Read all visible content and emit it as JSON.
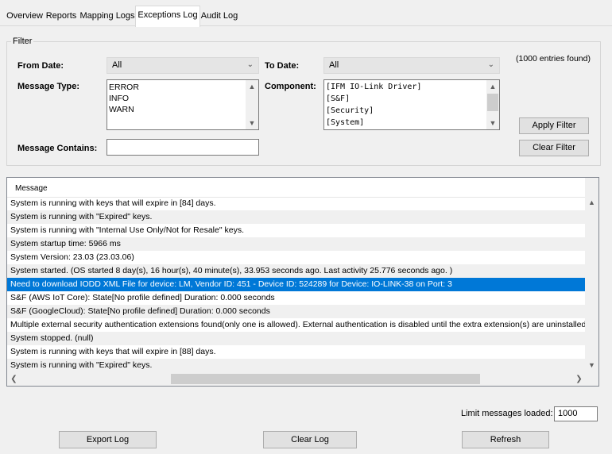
{
  "tabs": [
    {
      "label": "Overview",
      "active": false
    },
    {
      "label": "Reports",
      "active": false
    },
    {
      "label": "Mapping Logs",
      "active": false
    },
    {
      "label": "Exceptions Log",
      "active": true
    },
    {
      "label": "Audit Log",
      "active": false
    }
  ],
  "filter": {
    "legend": "Filter",
    "from_date_label": "From Date:",
    "from_date_value": "All",
    "to_date_label": "To Date:",
    "to_date_value": "All",
    "entries_found": "(1000 entries found)",
    "message_type_label": "Message Type:",
    "message_types": [
      "ERROR",
      "INFO",
      "WARN"
    ],
    "component_label": "Component:",
    "components": [
      "[IFM IO-Link Driver]",
      "[S&F]",
      "[Security]",
      "[System]"
    ],
    "message_contains_label": "Message Contains:",
    "message_contains_value": "",
    "apply_label": "Apply Filter",
    "clear_label": "Clear Filter"
  },
  "messages": {
    "column_header": "Message",
    "rows": [
      "System is running with keys that will expire in [84] days.",
      "System is running with \"Expired\" keys.",
      "System is running with \"Internal Use Only/Not for Resale\" keys.",
      "System startup time: 5966 ms",
      "System Version: 23.03 (23.03.06)",
      "System started. (OS started 8 day(s), 16 hour(s), 40 minute(s), 33.953 seconds ago. Last activity 25.776 seconds ago. )",
      "Need to download IODD XML File for device: LM, Vendor ID: 451 - Device ID: 524289 for Device: IO-LINK-38 on Port: 3",
      "S&F (AWS IoT Core): State[No profile defined] Duration: 0.000 seconds",
      "S&F (GoogleCloud): State[No profile defined] Duration: 0.000 seconds",
      "Multiple external security authentication extensions found(only one is allowed).  External authentication is disabled until the extra extension(s) are uninstalled",
      "System stopped. (null)",
      "System is running with keys that will expire in [88] days.",
      "System is running with \"Expired\" keys."
    ],
    "selected_index": 6
  },
  "footer": {
    "limit_label": "Limit messages loaded:",
    "limit_value": "1000",
    "export_label": "Export Log",
    "clear_log_label": "Clear Log",
    "refresh_label": "Refresh"
  },
  "icons": {
    "chevron_down": "chevron-down-icon",
    "arrow_up": "arrow-up-icon",
    "arrow_down": "arrow-down-icon",
    "arrow_left": "arrow-left-icon",
    "arrow_right": "arrow-right-icon"
  },
  "colors": {
    "selection": "#0078d7",
    "alt_row": "#f0f0f0",
    "window_bg": "#f0f0f0"
  }
}
